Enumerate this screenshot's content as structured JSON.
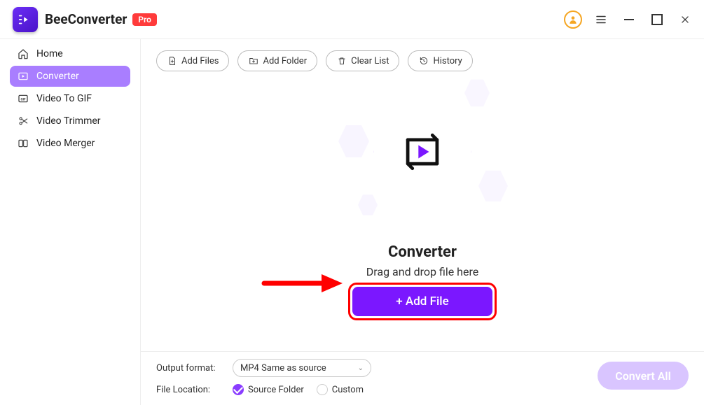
{
  "header": {
    "app_name": "BeeConverter",
    "badge": "Pro"
  },
  "sidebar": {
    "items": [
      {
        "label": "Home",
        "icon": "home"
      },
      {
        "label": "Converter",
        "icon": "converter"
      },
      {
        "label": "Video To GIF",
        "icon": "gif"
      },
      {
        "label": "Video Trimmer",
        "icon": "trimmer"
      },
      {
        "label": "Video Merger",
        "icon": "merger"
      }
    ],
    "active_index": 1
  },
  "toolbar": {
    "add_files": "Add Files",
    "add_folder": "Add Folder",
    "clear_list": "Clear List",
    "history": "History"
  },
  "center": {
    "title": "Converter",
    "subtitle": "Drag and drop file here",
    "add_file_button": "+ Add File"
  },
  "footer": {
    "output_format_label": "Output format:",
    "output_format_value": "MP4 Same as source",
    "file_location_label": "File Location:",
    "location_options": {
      "source_folder": "Source Folder",
      "custom": "Custom",
      "selected": "source_folder"
    },
    "convert_all": "Convert All"
  },
  "colors": {
    "accent": "#7b17ff",
    "sidebar_active": "#a97eff",
    "annotation": "#ff0000"
  }
}
